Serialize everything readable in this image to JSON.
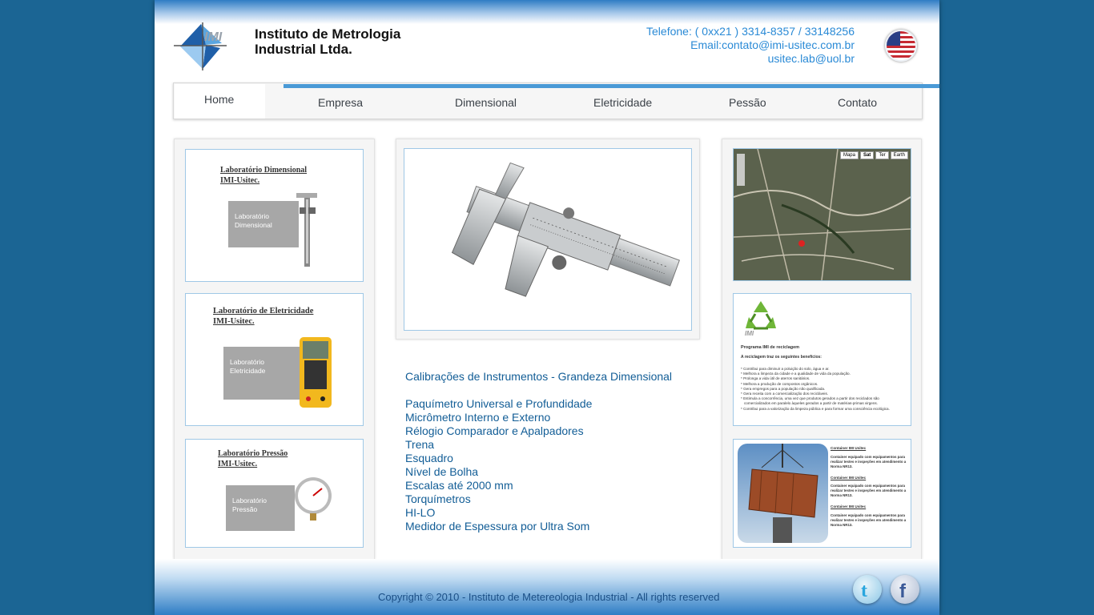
{
  "header": {
    "logo_text_line1": "Instituto de Metrologia",
    "logo_text_line2": "Industrial Ltda.",
    "phone": "Telefone: ( 0xx21 ) 3314-8357 / 33148256",
    "email": "Email:contato@imi-usitec.com.br",
    "email2": "usitec.lab@uol.br",
    "flag_icon": "us-flag-icon"
  },
  "nav": {
    "items": [
      {
        "label": "Home"
      },
      {
        "label": "Empresa"
      },
      {
        "label": "Dimensional"
      },
      {
        "label": "Eletricidade"
      },
      {
        "label": "Pessão"
      },
      {
        "label": "Contato"
      }
    ]
  },
  "left_cards": [
    {
      "title1": "Laboratório Dimensional",
      "title2": "IMI-Usitec.",
      "box_line1": "Laboratório",
      "box_line2": "Dimensional"
    },
    {
      "title1": "Laboratório de Eletricidade",
      "title2": "IMI-Usitec.",
      "box_line1": "Laboratório",
      "box_line2": "Eletricidade"
    },
    {
      "title1": "Laboratório Pressão",
      "title2": "IMI-Usitec.",
      "box_line1": "Laboratório",
      "box_line2": "Pressão"
    }
  ],
  "main": {
    "heading": "Calibrações de Instrumentos - Grandeza Dimensional",
    "items": [
      "Paquímetro Universal e Profundidade",
      "Micrômetro Interno e Externo",
      "Rélogio Comparador e Apalpadores",
      "Trena",
      "Esquadro",
      "Nível de Bolha",
      "Escalas até 2000 mm",
      "Torquímetros",
      "HI-LO",
      "Medidor de Espessura por Ultra Som"
    ]
  },
  "map": {
    "buttons": [
      "Mapa",
      "Sat",
      "Ter",
      "Earth"
    ]
  },
  "recycle": {
    "logo_text": "IMI",
    "title": "Programa IMI de reciclagem",
    "subtitle": "A reciclagem traz os seguintes benefícios:",
    "bullets": [
      "* Contribui para diminuir a poluição do solo, água e ar.",
      "* Melhora a limpeza da cidade e a qualidade de vida da população.",
      "* Prolonga a vida útil de aterros sanitários.",
      "* Melhora a produção de compostos orgânicos.",
      "* Gera empregos para a população não qualificada.",
      "* Gera receita com a comercialização dos recicláveis.",
      "* Estimula a concorrência, uma vez que produtos gerados a partir dos reciclados são",
      "comercializados em paralelo àqueles gerados a partir de matérias-primas virgens.",
      "* Contribui para a valorização da limpeza pública e para formar uma consciência ecológica."
    ]
  },
  "container": {
    "blocks": [
      {
        "title": "Container IMI Usitec",
        "text": "Container equipado com equipamentos para realizar testes e inspeções em atendimento a Norma NR13."
      },
      {
        "title": "Container IMI Usitec",
        "text": "Container equipado com equipamentos para realizar testes e inspeções em atendimento a Norma NR13."
      },
      {
        "title": "Container IMI Usitec",
        "text": "Container equipado com equipamentos para realizar testes e inspeções em atendimento a Norma NR13."
      }
    ]
  },
  "footer": {
    "copyright": "Copyright © 2010 - Instituto de Metereologia Industrial - All rights reserved",
    "social": [
      "twitter-icon",
      "facebook-icon"
    ]
  },
  "colors": {
    "background": "#1b6594",
    "accent": "#4a9ad6",
    "link": "#125d96"
  }
}
